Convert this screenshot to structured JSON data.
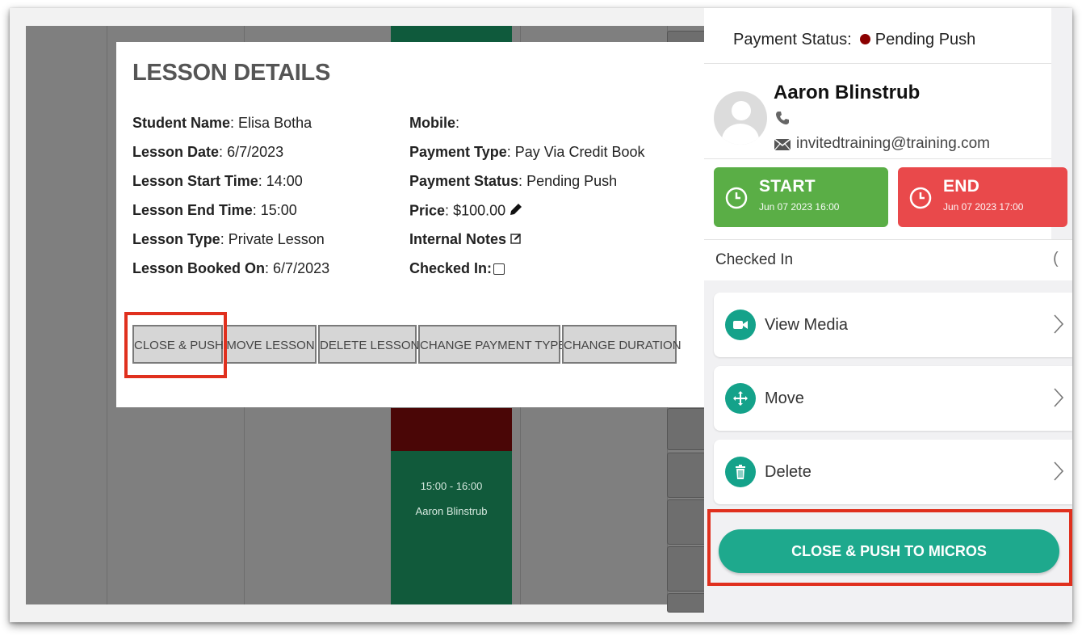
{
  "modal": {
    "title": "LESSON DETAILS",
    "left_fields": [
      {
        "label": "Student Name",
        "value": "Elisa Botha"
      },
      {
        "label": "Lesson Date",
        "value": "6/7/2023"
      },
      {
        "label": "Lesson Start Time",
        "value": "14:00"
      },
      {
        "label": "Lesson End Time",
        "value": "15:00"
      },
      {
        "label": "Lesson Type",
        "value": "Private Lesson"
      },
      {
        "label": "Lesson Booked On",
        "value": "6/7/2023"
      }
    ],
    "right_fields": [
      {
        "label": "Mobile",
        "value": ""
      },
      {
        "label": "Payment Type",
        "value": "Pay Via Credit Book"
      },
      {
        "label": "Payment Status",
        "value": "Pending Push"
      },
      {
        "label": "Price",
        "value": "$100.00"
      },
      {
        "label": "Internal Notes",
        "value": ""
      },
      {
        "label": "Checked In",
        "value": ""
      }
    ],
    "buttons": {
      "close_push": "CLOSE & PUSH",
      "move": "MOVE LESSON",
      "delete": "DELETE LESSON",
      "change_payment": "CHANGE PAYMENT TYPE",
      "change_duration": "CHANGE DURATION"
    }
  },
  "calendar": {
    "event": {
      "time": "15:00 - 16:00",
      "name": "Aaron Blinstrub"
    }
  },
  "panel": {
    "payment_status_label": "Payment Status:",
    "payment_status_value": "Pending Push",
    "user_name": "Aaron Blinstrub",
    "email": "invitedtraining@training.com",
    "start": {
      "label": "START",
      "time": "Jun 07 2023  16:00"
    },
    "end": {
      "label": "END",
      "time": "Jun 07 2023  17:00"
    },
    "checked_in": "Checked In",
    "checked_in_paren": "(",
    "menu": [
      {
        "label": "View Media",
        "icon": "video-icon"
      },
      {
        "label": "Move",
        "icon": "move-icon"
      },
      {
        "label": "Delete",
        "icon": "trash-icon"
      }
    ],
    "push_button": "CLOSE & PUSH TO MICROS"
  },
  "colors": {
    "start_green": "#5aae46",
    "end_red": "#e9494b",
    "teal": "#1ea98d",
    "highlight": "#e0301e",
    "event_green": "#115a3b",
    "event_red": "#4a0606"
  }
}
